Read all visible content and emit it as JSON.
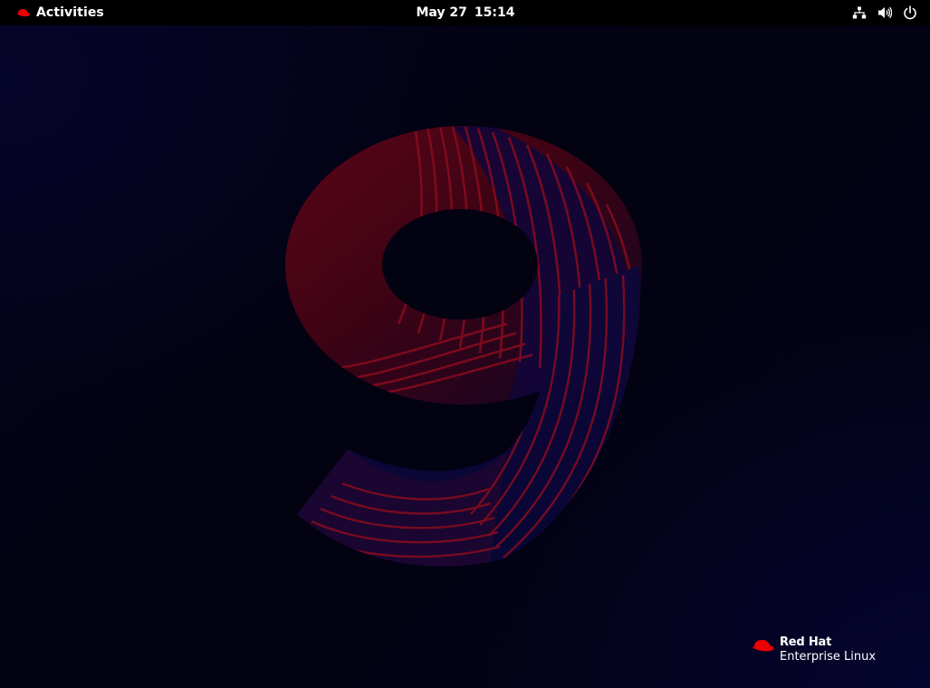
{
  "topbar": {
    "activities_label": "Activities",
    "activities_icon": "redhat-fedora-icon",
    "clock": {
      "date": "May 27",
      "time": "15:14"
    },
    "status_icons": [
      "network-wired-icon",
      "volume-icon",
      "power-icon"
    ]
  },
  "desktop": {
    "wallpaper": "rhel-9",
    "brand": {
      "name": "Red Hat",
      "product": "Enterprise Linux"
    }
  },
  "colors": {
    "topbar_bg": "#000000",
    "desktop_bg": "#03031a",
    "accent_red": "#ee0000"
  }
}
